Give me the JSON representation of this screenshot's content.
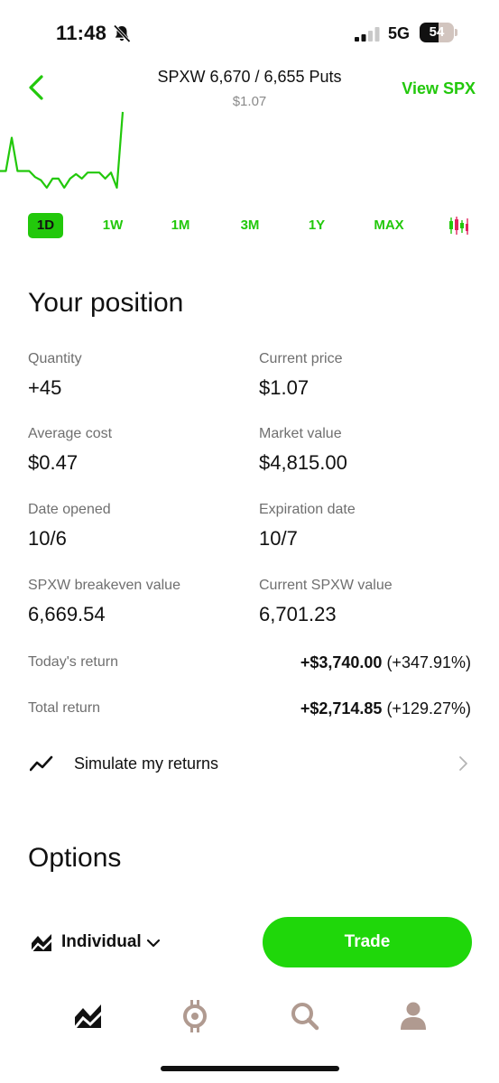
{
  "status_bar": {
    "time": "11:48",
    "network": "5G",
    "battery": "54",
    "battery_level_percent": 54
  },
  "header": {
    "title": "SPXW 6,670 / 6,655 Puts",
    "subtitle": "$1.07",
    "view_link": "View SPX"
  },
  "chart": {
    "line_color": "#22c80b",
    "values": [
      1.02,
      1.02,
      1.24,
      1.02,
      1.02,
      1.02,
      0.98,
      0.96,
      0.91,
      0.97,
      0.97,
      0.91,
      0.97,
      1.0,
      0.97,
      1.01,
      1.01,
      1.01,
      0.97,
      1.01,
      0.91,
      1.41
    ]
  },
  "range_tabs": [
    "1D",
    "1W",
    "1M",
    "3M",
    "1Y",
    "MAX"
  ],
  "active_range": "1D",
  "position": {
    "title": "Your position",
    "stats": [
      {
        "label": "Quantity",
        "value": "+45"
      },
      {
        "label": "Current price",
        "value": "$1.07"
      },
      {
        "label": "Average cost",
        "value": "$0.47"
      },
      {
        "label": "Market value",
        "value": "$4,815.00"
      },
      {
        "label": "Date opened",
        "value": "10/6"
      },
      {
        "label": "Expiration date",
        "value": "10/7"
      },
      {
        "label": "SPXW breakeven value",
        "value": "6,669.54"
      },
      {
        "label": "Current SPXW value",
        "value": "6,701.23"
      }
    ],
    "todays_return": {
      "label": "Today's return",
      "amount": "+$3,740.00",
      "percent": "(+347.91%)"
    },
    "total_return": {
      "label": "Total return",
      "amount": "+$2,714.85",
      "percent": "(+129.27%)"
    },
    "simulate_label": "Simulate my returns"
  },
  "options": {
    "title": "Options",
    "account_label": "Individual",
    "trade_label": "Trade"
  },
  "colors": {
    "accent": "#22c80b",
    "trade_button": "#1fd70a",
    "muted_text": "#6f6f6f"
  },
  "tab_bar": {
    "items": [
      "investing-icon",
      "crypto-icon",
      "search-icon",
      "account-icon"
    ]
  }
}
